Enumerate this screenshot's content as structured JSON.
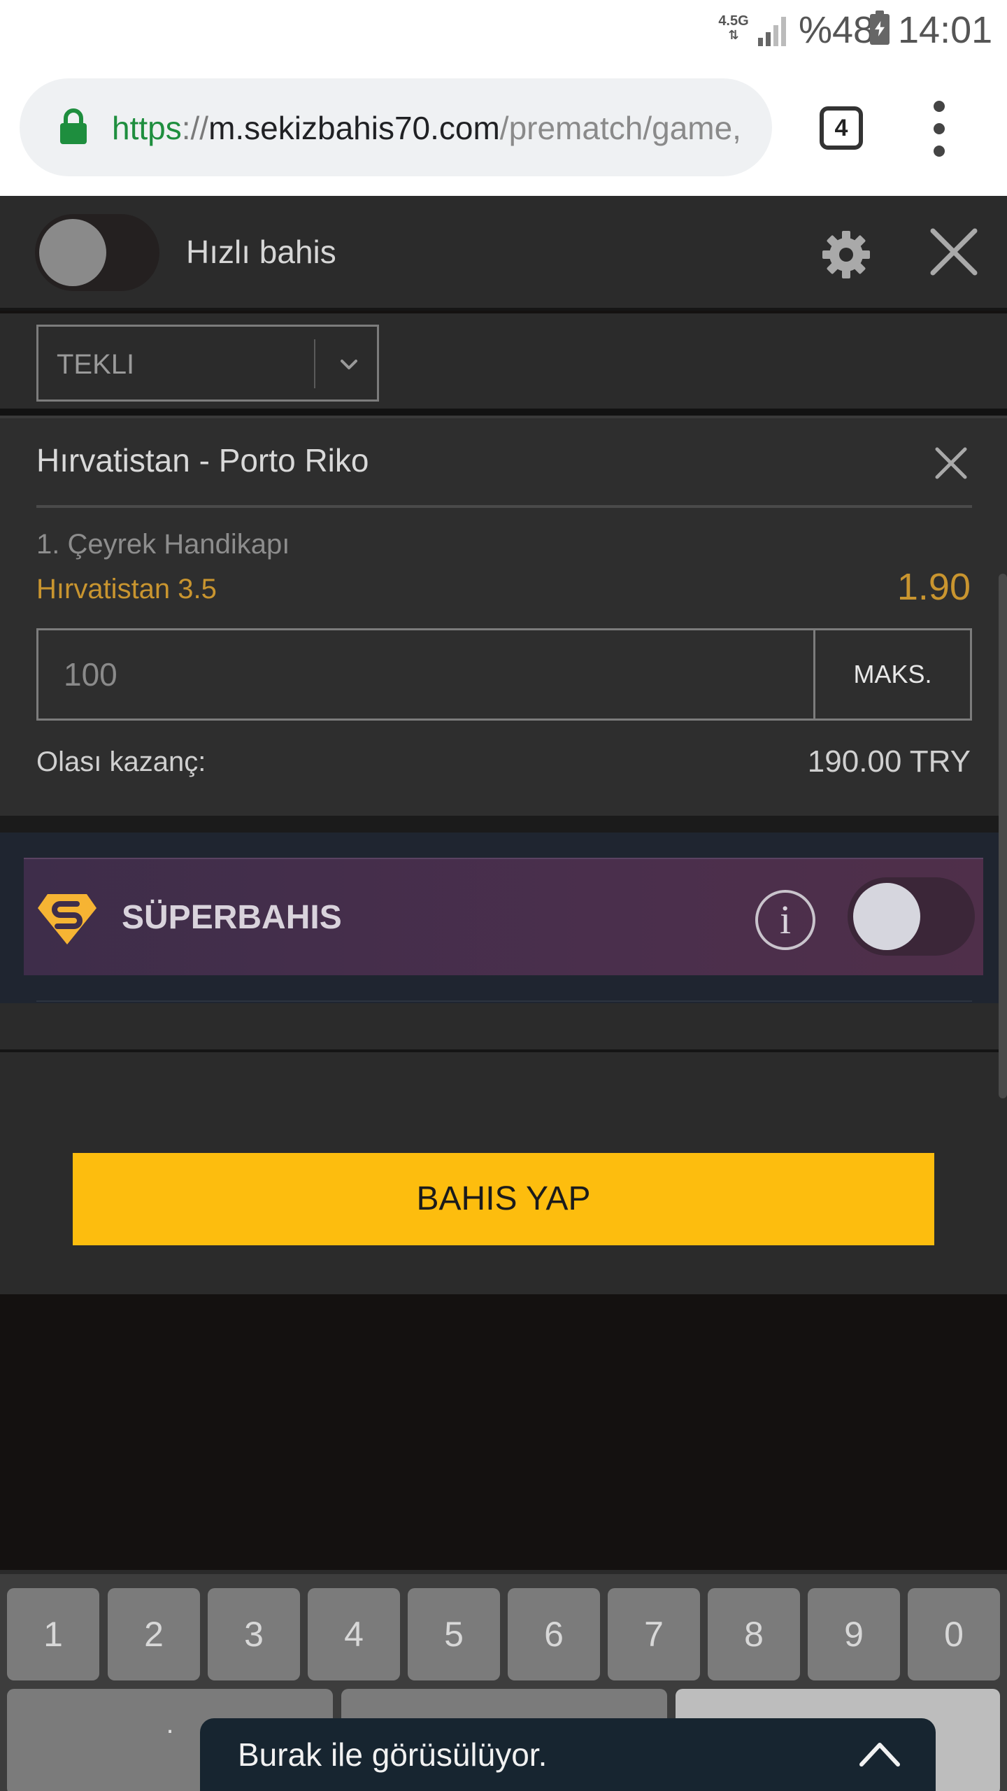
{
  "status_bar": {
    "network_type": "4.5G",
    "network_arrows": "⇅",
    "battery_percent": "%48",
    "time": "14:01"
  },
  "browser": {
    "url_scheme": "https",
    "url_separator": "://",
    "url_host": "m.sekizbahis70.com",
    "url_path": "/prematch/game,",
    "tab_count": "4"
  },
  "header": {
    "quick_bet_label": "Hızlı bahis",
    "quick_bet_enabled": false
  },
  "bet_type": {
    "selected": "TEKLI"
  },
  "bet_slip": {
    "match": "Hırvatistan - Porto Riko",
    "market": "1. Çeyrek Handikapı",
    "selection": "Hırvatistan 3.5",
    "odds": "1.90",
    "stake_placeholder": "100",
    "max_label": "MAKS.",
    "winnings_label": "Olası kazanç:",
    "winnings_value": "190.00 TRY"
  },
  "superbahis": {
    "label": "SÜPERBAHIS",
    "info_glyph": "i",
    "enabled": false
  },
  "actions": {
    "place_bet_label": "BAHIS YAP"
  },
  "keyboard": {
    "number_keys": [
      "1",
      "2",
      "3",
      "4",
      "5",
      "6",
      "7",
      "8",
      "9",
      "0"
    ],
    "dot_key": "."
  },
  "toast": {
    "text": "Burak ile görüsülüyor."
  },
  "colors": {
    "accent_yellow": "#fdbd0e",
    "odds_gold": "#c9952f",
    "page_dark": "#2b2b2b",
    "superbahis_purple": "#4a2f4c",
    "url_green": "#1e8e3e"
  }
}
